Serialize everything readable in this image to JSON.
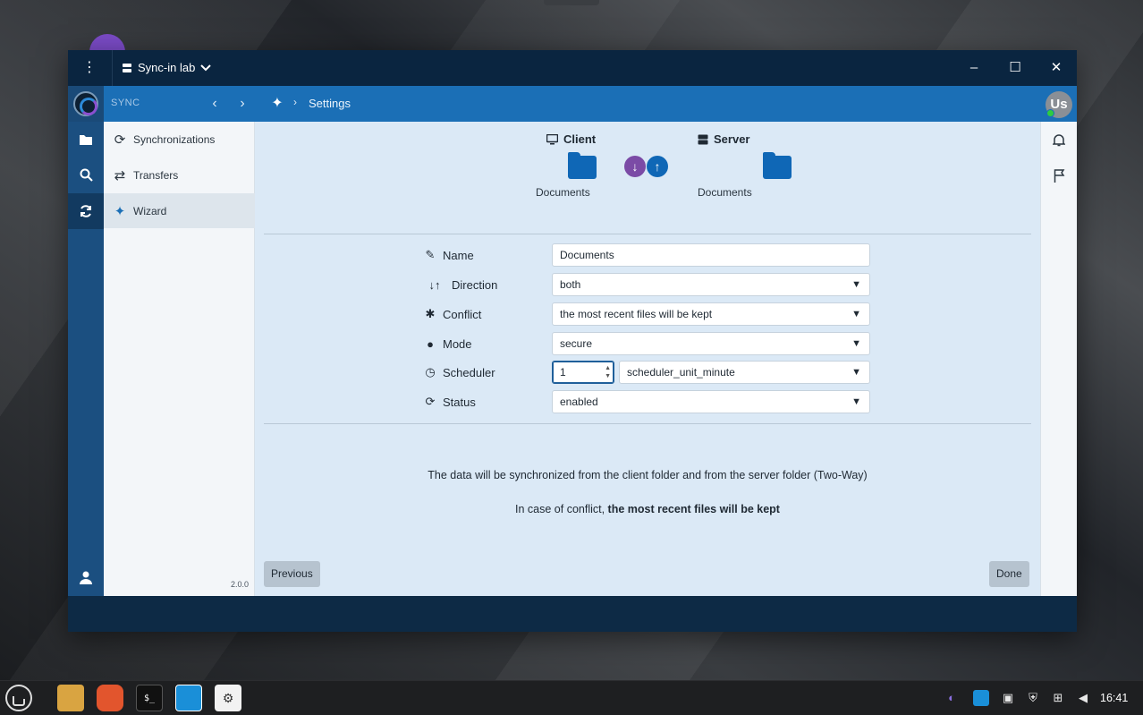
{
  "window": {
    "menu_icon": "⋮",
    "server_name": "Sync-in lab",
    "minimize": "–",
    "maximize": "☐",
    "close": "✕"
  },
  "navbar": {
    "section": "SYNC",
    "back": "‹",
    "forward": "›",
    "breadcrumb_sep": "›",
    "breadcrumb": "Settings",
    "avatar_initials": "Us"
  },
  "sidebar": {
    "items": [
      {
        "label": "Synchronizations",
        "icon": "sync-icon"
      },
      {
        "label": "Transfers",
        "icon": "transfers-icon"
      },
      {
        "label": "Wizard",
        "icon": "wand-icon"
      }
    ],
    "version": "2.0.0"
  },
  "wizard": {
    "client_label": "Client",
    "server_label": "Server",
    "client_folder": "Documents",
    "server_folder": "Documents",
    "down_arrow": "↓",
    "up_arrow": "↑",
    "fields": {
      "name_label": "Name",
      "name_value": "Documents",
      "direction_label": "Direction",
      "direction_value": "both",
      "conflict_label": "Conflict",
      "conflict_value": "the most recent files will be kept",
      "mode_label": "Mode",
      "mode_value": "secure",
      "scheduler_label": "Scheduler",
      "scheduler_value": "1",
      "scheduler_unit": "scheduler_unit_minute",
      "status_label": "Status",
      "status_value": "enabled"
    },
    "summary_line1": "The data will be synchronized from the client folder and from the server folder (Two-Way)",
    "summary_line2_prefix": "In case of conflict, ",
    "summary_line2_bold": "the most recent files will be kept",
    "previous": "Previous",
    "done": "Done"
  },
  "taskbar": {
    "clock": "16:41",
    "terminal_label": "$_"
  },
  "colors": {
    "navbar": "#1b6fb6",
    "titlebar": "#0a2540",
    "main_bg": "#dbe9f6",
    "folder": "#0f67b6",
    "down_circle": "#7b4ba6",
    "up_circle": "#0f67b6"
  }
}
